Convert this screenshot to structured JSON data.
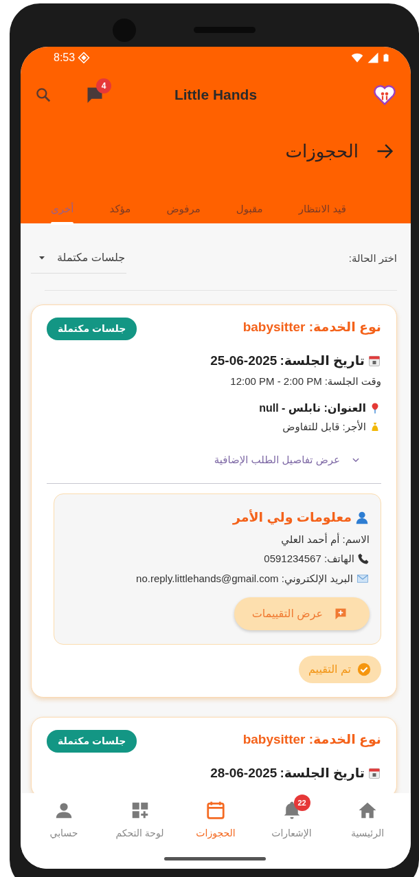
{
  "status_bar": {
    "time": "8:53"
  },
  "app_bar": {
    "title": "Little Hands",
    "chat_badge": "4"
  },
  "page": {
    "title": "الحجوزات"
  },
  "tabs": [
    {
      "label": "قيد الانتظار",
      "selected": false
    },
    {
      "label": "مقبول",
      "selected": false
    },
    {
      "label": "مرفوض",
      "selected": false
    },
    {
      "label": "مؤكد",
      "selected": false
    },
    {
      "label": "أخرى",
      "selected": true
    }
  ],
  "filter": {
    "label": "اختر الحالة:",
    "value": "جلسات مكتملة"
  },
  "bookings": [
    {
      "service": "نوع الخدمة: babysitter",
      "status": "جلسات مكتملة",
      "date_label": "تاريخ الجلسة:",
      "date": "25-06-2025",
      "time_label": "وقت الجلسة:",
      "time": "12:00 PM - 2:00 PM",
      "address": "العنوان: نابلس - null",
      "fee": "الأجر: قابل للتفاوض",
      "details_toggle": "عرض تفاصيل الطلب الإضافية",
      "expanded": false,
      "parent": {
        "title": "معلومات ولي الأمر",
        "name": "الاسم: أم أحمد العلي",
        "phone": "الهاتف: 0591234567",
        "email": "البريد الإلكتروني: no.reply.littlehands@gmail.com",
        "reviews_button": "عرض التقييمات"
      },
      "rated_label": "تم التقييم"
    },
    {
      "service": "نوع الخدمة: babysitter",
      "status": "جلسات مكتملة",
      "date_label": "تاريخ الجلسة:",
      "date": "28-06-2025"
    }
  ],
  "bottom_nav": [
    {
      "label": "الرئيسية",
      "kind": "home",
      "selected": false
    },
    {
      "label": "الإشعارات",
      "kind": "bell",
      "badge": "22",
      "selected": false
    },
    {
      "label": "الحجوزات",
      "kind": "calendar",
      "selected": true
    },
    {
      "label": "لوحة التحكم",
      "kind": "dashboard",
      "selected": false
    },
    {
      "label": "حسابي",
      "kind": "person",
      "selected": false
    }
  ]
}
